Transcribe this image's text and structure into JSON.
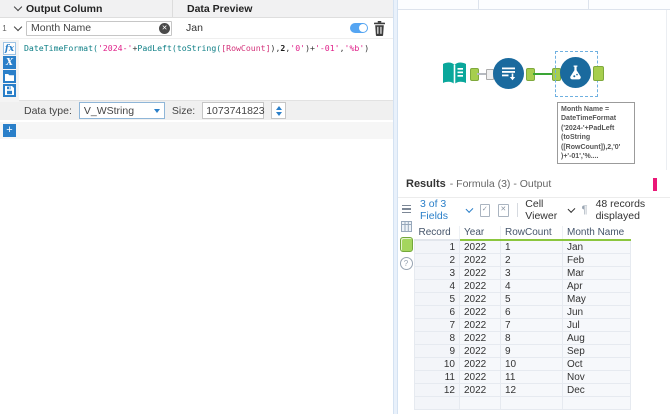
{
  "config": {
    "header": {
      "output_column": "Output Column",
      "data_preview": "Data Preview"
    },
    "row": {
      "number": "1",
      "field_value": "Month Name",
      "preview": "Jan"
    },
    "formula": {
      "segments": [
        {
          "text": "DateTimeFormat(",
          "type": "fn"
        },
        {
          "text": "'2024-'",
          "type": "str"
        },
        {
          "text": "+",
          "type": "op"
        },
        {
          "text": "PadLeft(",
          "type": "fn"
        },
        {
          "text": "toString(",
          "type": "fn"
        },
        {
          "text": "[RowCount]",
          "type": "field"
        },
        {
          "text": ")",
          "type": "op"
        },
        {
          "text": ",",
          "type": "op"
        },
        {
          "text": "2",
          "type": "num"
        },
        {
          "text": ",",
          "type": "op"
        },
        {
          "text": "'0'",
          "type": "str"
        },
        {
          "text": ")",
          "type": "op"
        },
        {
          "text": "+",
          "type": "op"
        },
        {
          "text": "'-01'",
          "type": "str"
        },
        {
          "text": ",",
          "type": "op"
        },
        {
          "text": "'%b'",
          "type": "str"
        },
        {
          "text": ")",
          "type": "op"
        }
      ]
    },
    "data_type": {
      "label": "Data type:",
      "value": "V_WString",
      "size_label": "Size:",
      "size_value": "1073741823"
    }
  },
  "canvas": {
    "annotation_lines": [
      "Month Name =",
      "DateTimeFormat",
      "('2024-'+PadLeft",
      "(toString",
      "([RowCount]),2,'0'",
      ")+'-01','%...."
    ]
  },
  "results": {
    "title": "Results",
    "subtitle": "- Formula (3) - Output",
    "toolbar": {
      "fields": "3 of 3 Fields",
      "cell_viewer": "Cell Viewer",
      "records": "48 records displayed"
    },
    "table": {
      "columns": [
        "Record",
        "Year",
        "RowCount",
        "Month Name"
      ],
      "rows": [
        [
          "1",
          "2022",
          "1",
          "Jan"
        ],
        [
          "2",
          "2022",
          "2",
          "Feb"
        ],
        [
          "3",
          "2022",
          "3",
          "Mar"
        ],
        [
          "4",
          "2022",
          "4",
          "Apr"
        ],
        [
          "5",
          "2022",
          "5",
          "May"
        ],
        [
          "6",
          "2022",
          "6",
          "Jun"
        ],
        [
          "7",
          "2022",
          "7",
          "Jul"
        ],
        [
          "8",
          "2022",
          "8",
          "Aug"
        ],
        [
          "9",
          "2022",
          "9",
          "Sep"
        ],
        [
          "10",
          "2022",
          "10",
          "Oct"
        ],
        [
          "11",
          "2022",
          "11",
          "Nov"
        ],
        [
          "12",
          "2022",
          "12",
          "Dec"
        ]
      ]
    }
  },
  "icons": {
    "fx": "fx",
    "variable": "X",
    "plus": "+",
    "clear": "✕",
    "check": "✓",
    "cross": "✕",
    "pilcrow": "¶",
    "help": "?"
  },
  "colors": {
    "accent_blue": "#2a7fc9",
    "toggle_blue": "#55a5f2",
    "tool_blue": "#1a6a9e",
    "tool_teal": "#0aa79b",
    "anchor_green": "#a6ce4e",
    "connection_green": "#3aa535",
    "quality_green": "#8bc63e",
    "magenta_bar": "#ea1777",
    "formula_function": "#0e7f86",
    "formula_string": "#e0218a"
  }
}
